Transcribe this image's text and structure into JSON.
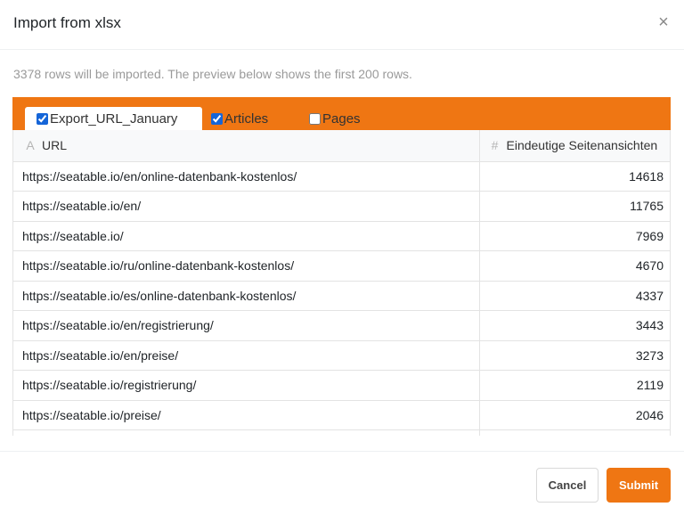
{
  "dialog": {
    "title": "Import from xlsx",
    "close_icon": "×",
    "info_text": "3378 rows will be imported. The preview below shows the first 200 rows."
  },
  "tabs": [
    {
      "label": "Export_URL_January",
      "checked": true,
      "active": true
    },
    {
      "label": "Articles",
      "checked": true,
      "active": false
    },
    {
      "label": "Pages",
      "checked": false,
      "active": false
    }
  ],
  "table": {
    "columns": [
      {
        "label": "URL",
        "icon": "A"
      },
      {
        "label": "Eindeutige Seitenansichten",
        "icon": "#"
      }
    ],
    "rows": [
      {
        "url": "https://seatable.io/en/online-datenbank-kostenlos/",
        "views": "14618"
      },
      {
        "url": "https://seatable.io/en/",
        "views": "11765"
      },
      {
        "url": "https://seatable.io/",
        "views": "7969"
      },
      {
        "url": "https://seatable.io/ru/online-datenbank-kostenlos/",
        "views": "4670"
      },
      {
        "url": "https://seatable.io/es/online-datenbank-kostenlos/",
        "views": "4337"
      },
      {
        "url": "https://seatable.io/en/registrierung/",
        "views": "3443"
      },
      {
        "url": "https://seatable.io/en/preise/",
        "views": "3273"
      },
      {
        "url": "https://seatable.io/registrierung/",
        "views": "2119"
      },
      {
        "url": "https://seatable.io/preise/",
        "views": "2046"
      },
      {
        "url": "",
        "views": ""
      }
    ]
  },
  "footer": {
    "cancel_label": "Cancel",
    "submit_label": "Submit"
  },
  "colors": {
    "accent": "#ef7613",
    "checkbox": "#1565d8"
  }
}
